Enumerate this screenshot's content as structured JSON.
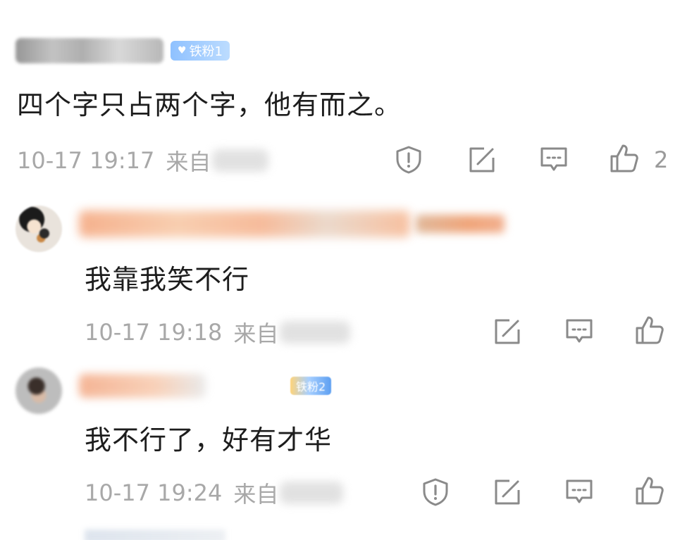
{
  "comments": [
    {
      "badge": "铁粉1",
      "text": "四个字只占两个字，他有而之。",
      "time": "10-17 19:17",
      "from": "来自",
      "like_count": "2"
    }
  ],
  "replies": [
    {
      "text": "我靠我笑不行",
      "time": "10-17 19:18",
      "from": "来自"
    },
    {
      "badge": "铁粉2",
      "text": "我不行了，好有才华",
      "time": "10-17 19:24",
      "from": "来自"
    }
  ],
  "colors": {
    "meta_gray": "#a8a8a8",
    "icon_gray": "#8a8a8a",
    "badge_blue": "#8fc1ff"
  },
  "icons": {
    "report": "shield-exclaim-icon",
    "share": "external-link-icon",
    "comment": "comment-bubble-icon",
    "like": "thumbs-up-icon"
  }
}
